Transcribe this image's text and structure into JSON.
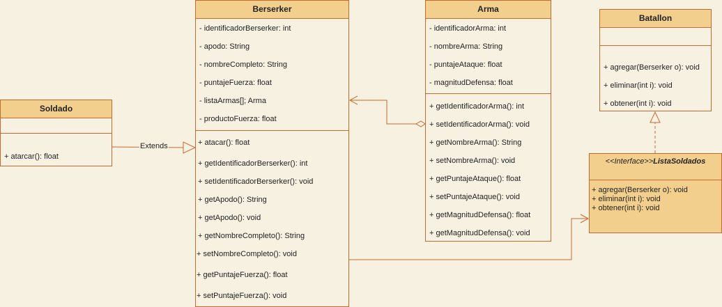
{
  "soldado": {
    "name": "Soldado",
    "methods": [
      "+ atarcar(): float"
    ]
  },
  "berserker": {
    "name": "Berserker",
    "attributes": [
      "- identificadorBerserker: int",
      "- apodo: String",
      "- nombreCompleto: String",
      "- puntajeFuerza: float",
      "- listaArmas[]; Arma",
      "- productoFuerza: float"
    ],
    "methods": [
      "+ atacar(): float",
      "+ getIdentificadorBerserker(): int",
      "+ setIdentificadorBerserker(): void",
      "+ getApodo(): String",
      "+ getApodo(): void",
      "+ getNombreCompleto(): String",
      "+ setNombreCompleto(): void",
      "+ getPuntajeFuerza(): float",
      "+ setPuntajeFuerza(): void"
    ]
  },
  "arma": {
    "name": "Arma",
    "attributes": [
      "- identificadorArma: int",
      "- nombreArma: String",
      "- puntajeAtaque: float",
      "- magnitudDefensa: float"
    ],
    "methods": [
      "+ getIdentificadorArma(): int",
      "+ setIdentificadorArma(): void",
      "+ getNombreArma(): String",
      "+ setNombreArma(): void",
      "+ getPuntajeAtaque(): float",
      "+ setPuntajeAtaque(): void",
      "+ getMagnitudDefensa(): float",
      "+ getMagnitudDefensa(): void"
    ]
  },
  "batallon": {
    "name": "Batallon",
    "methods": [
      "+ agregar(Berserker o): void",
      "+ eliminar(int i): void",
      "+ obtener(int i): void"
    ]
  },
  "lista_soldados": {
    "stereotype": "<<Interface>>",
    "name": "ListaSoldados",
    "methods": [
      "+ agregar(Berserker o): void",
      "+ eliminar(int i): void",
      "+ obtener(int i): void"
    ]
  },
  "edges": {
    "extends_label": "Extends"
  },
  "colors": {
    "background": "#f7f1e1",
    "header_fill": "#f3cf8d",
    "stroke": "#c8692f"
  }
}
